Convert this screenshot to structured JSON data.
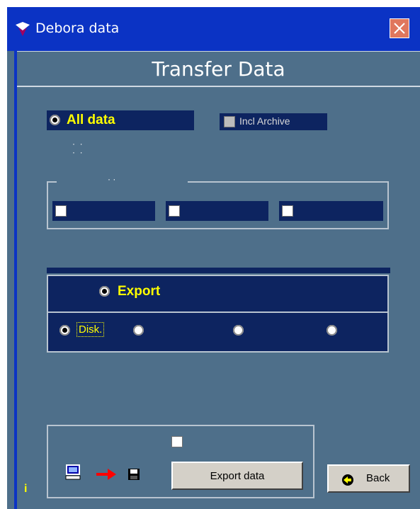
{
  "window": {
    "title": "Debora data",
    "app_icon": "debora-app-icon",
    "close_icon": "close-icon"
  },
  "header": {
    "title": "Transfer Data"
  },
  "selection": {
    "all_data_label": "All data",
    "all_data_checked": true,
    "incl_archive_label": "Incl Archive",
    "incl_archive_checked": false
  },
  "group_checkboxes": [
    {
      "label": "",
      "checked": false
    },
    {
      "label": "",
      "checked": false
    },
    {
      "label": "",
      "checked": false
    }
  ],
  "export_section": {
    "export_label": "Export",
    "export_checked": true,
    "destinations": [
      {
        "label": "Disk.",
        "checked": true
      },
      {
        "label": "",
        "checked": false
      },
      {
        "label": "",
        "checked": false
      },
      {
        "label": "",
        "checked": false
      }
    ]
  },
  "actions": {
    "export_button_label": "Export data",
    "back_button_label": "Back",
    "bottom_checkbox_checked": false,
    "icons": [
      "computer-icon",
      "arrow-right-icon",
      "floppy-disk-icon",
      "back-arrow-icon",
      "info-icon"
    ],
    "info_glyph": "i"
  },
  "colors": {
    "background": "#4e6f8a",
    "titlebar": "#0b33c4",
    "panel": "#0d2460",
    "accent_text": "#ffff00",
    "close_button": "#e0775d"
  }
}
